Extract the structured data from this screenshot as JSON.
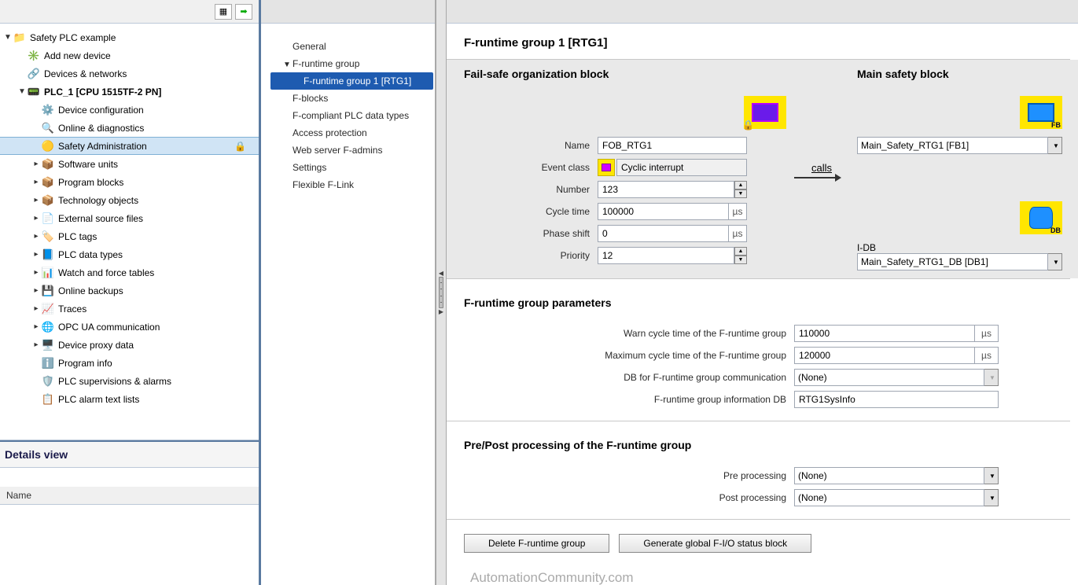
{
  "toolbar": {
    "btn_grid": "▦",
    "btn_go": "➡"
  },
  "tree": [
    {
      "lvl": 0,
      "exp": "▼",
      "icon": "📁",
      "lbl": "Safety PLC example",
      "color": "#3a6ea5"
    },
    {
      "lvl": 1,
      "icon": "✳️",
      "lbl": "Add new device",
      "color": "#3a9a3a"
    },
    {
      "lvl": 1,
      "icon": "🔗",
      "lbl": "Devices & networks",
      "color": "#2a6cb0"
    },
    {
      "lvl": 1,
      "exp": "▼",
      "icon": "📟",
      "lbl": "PLC_1 [CPU 1515TF-2 PN]",
      "bold": true,
      "color": "#1e90ff"
    },
    {
      "lvl": 2,
      "icon": "⚙️",
      "lbl": "Device configuration"
    },
    {
      "lvl": 2,
      "icon": "🔍",
      "lbl": "Online & diagnostics"
    },
    {
      "lvl": 2,
      "icon": "🟡",
      "lbl": "Safety Administration",
      "sel": true,
      "lock": true
    },
    {
      "lvl": 2,
      "exp": "▸",
      "icon": "📦",
      "lbl": "Software units",
      "folder": true
    },
    {
      "lvl": 2,
      "exp": "▸",
      "icon": "📦",
      "lbl": "Program blocks",
      "folder": true
    },
    {
      "lvl": 2,
      "exp": "▸",
      "icon": "📦",
      "lbl": "Technology objects",
      "folder": true
    },
    {
      "lvl": 2,
      "exp": "▸",
      "icon": "📄",
      "lbl": "External source files",
      "folder": true
    },
    {
      "lvl": 2,
      "exp": "▸",
      "icon": "🏷️",
      "lbl": "PLC tags",
      "folder": true
    },
    {
      "lvl": 2,
      "exp": "▸",
      "icon": "📘",
      "lbl": "PLC data types",
      "folder": true
    },
    {
      "lvl": 2,
      "exp": "▸",
      "icon": "📊",
      "lbl": "Watch and force tables",
      "folder": true
    },
    {
      "lvl": 2,
      "exp": "▸",
      "icon": "💾",
      "lbl": "Online backups",
      "folder": true
    },
    {
      "lvl": 2,
      "exp": "▸",
      "icon": "📈",
      "lbl": "Traces",
      "folder": true
    },
    {
      "lvl": 2,
      "exp": "▸",
      "icon": "🌐",
      "lbl": "OPC UA communication",
      "folder": true
    },
    {
      "lvl": 2,
      "exp": "▸",
      "icon": "🖥️",
      "lbl": "Device proxy data",
      "folder": true
    },
    {
      "lvl": 2,
      "icon": "ℹ️",
      "lbl": "Program info"
    },
    {
      "lvl": 2,
      "icon": "🛡️",
      "lbl": "PLC supervisions & alarms"
    },
    {
      "lvl": 2,
      "icon": "📋",
      "lbl": "PLC alarm text lists"
    }
  ],
  "details": {
    "header": "Details view",
    "col": "Name"
  },
  "nav": [
    {
      "lvl": 0,
      "lbl": "General"
    },
    {
      "lvl": 0,
      "exp": "▼",
      "lbl": "F-runtime group"
    },
    {
      "lvl": 1,
      "lbl": "F-runtime group 1 [RTG1]",
      "sel": true
    },
    {
      "lvl": 0,
      "lbl": "F-blocks"
    },
    {
      "lvl": 0,
      "lbl": "F-compliant PLC data types"
    },
    {
      "lvl": 0,
      "lbl": "Access protection"
    },
    {
      "lvl": 0,
      "lbl": "Web server F-admins"
    },
    {
      "lvl": 0,
      "lbl": "Settings"
    },
    {
      "lvl": 0,
      "lbl": "Flexible F-Link"
    }
  ],
  "content": {
    "title": "F-runtime group 1 [RTG1]",
    "fob": {
      "heading": "Fail-safe organization block",
      "name_label": "Name",
      "name_value": "FOB_RTG1",
      "event_label": "Event class",
      "event_value": "Cyclic interrupt",
      "number_label": "Number",
      "number_value": "123",
      "cycle_label": "Cycle time",
      "cycle_value": "100000",
      "cycle_unit": "µs",
      "phase_label": "Phase shift",
      "phase_value": "0",
      "phase_unit": "µs",
      "prio_label": "Priority",
      "prio_value": "12"
    },
    "calls": "calls",
    "msb": {
      "heading": "Main safety block",
      "fb_tag": "FB",
      "combo_value": "Main_Safety_RTG1 [FB1]",
      "idb_label": "I-DB",
      "db_tag": "DB",
      "idb_value": "Main_Safety_RTG1_DB [DB1]"
    },
    "params": {
      "heading": "F-runtime group parameters",
      "warn_label": "Warn cycle time of the F-runtime group",
      "warn_value": "110000",
      "warn_unit": "µs",
      "max_label": "Maximum cycle time of the F-runtime group",
      "max_value": "120000",
      "max_unit": "µs",
      "db_label": "DB for F-runtime group communication",
      "db_value": "(None)",
      "info_label": "F-runtime group information DB",
      "info_value": "RTG1SysInfo"
    },
    "prepost": {
      "heading": "Pre/Post processing of the F-runtime group",
      "pre_label": "Pre processing",
      "pre_value": "(None)",
      "post_label": "Post processing",
      "post_value": "(None)"
    },
    "btn_delete": "Delete F-runtime group",
    "btn_generate": "Generate global F-I/O status block",
    "watermark": "AutomationCommunity.com"
  }
}
